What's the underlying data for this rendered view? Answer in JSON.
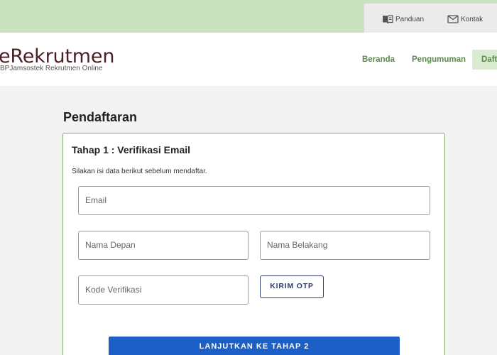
{
  "topbar": {
    "guide_label": "Panduan",
    "contact_label": "Kontak"
  },
  "header": {
    "logo_title": "eRekrutmen",
    "logo_subtitle": "BPJamsostek Rekrutmen Online",
    "nav": [
      "Beranda",
      "Pengumuman",
      "Daft"
    ]
  },
  "page": {
    "title": "Pendaftaran"
  },
  "form": {
    "step_title": "Tahap 1 : Verifikasi Email",
    "description": "Silakan isi data berikut sebelum mendaftar.",
    "email_placeholder": "Email",
    "first_name_placeholder": "Nama Depan",
    "last_name_placeholder": "Nama Belakang",
    "code_placeholder": "Kode Verifikasi",
    "otp_button": "KIRIM OTP",
    "next_button": "LANJUTKAN KE TAHAP 2"
  },
  "colors": {
    "top_strip": "#c9e3c1",
    "nav_text": "#5a8a4c",
    "card_border": "#7ab06a",
    "primary_button": "#1b5fc7",
    "otp_border": "#2e3a70"
  }
}
